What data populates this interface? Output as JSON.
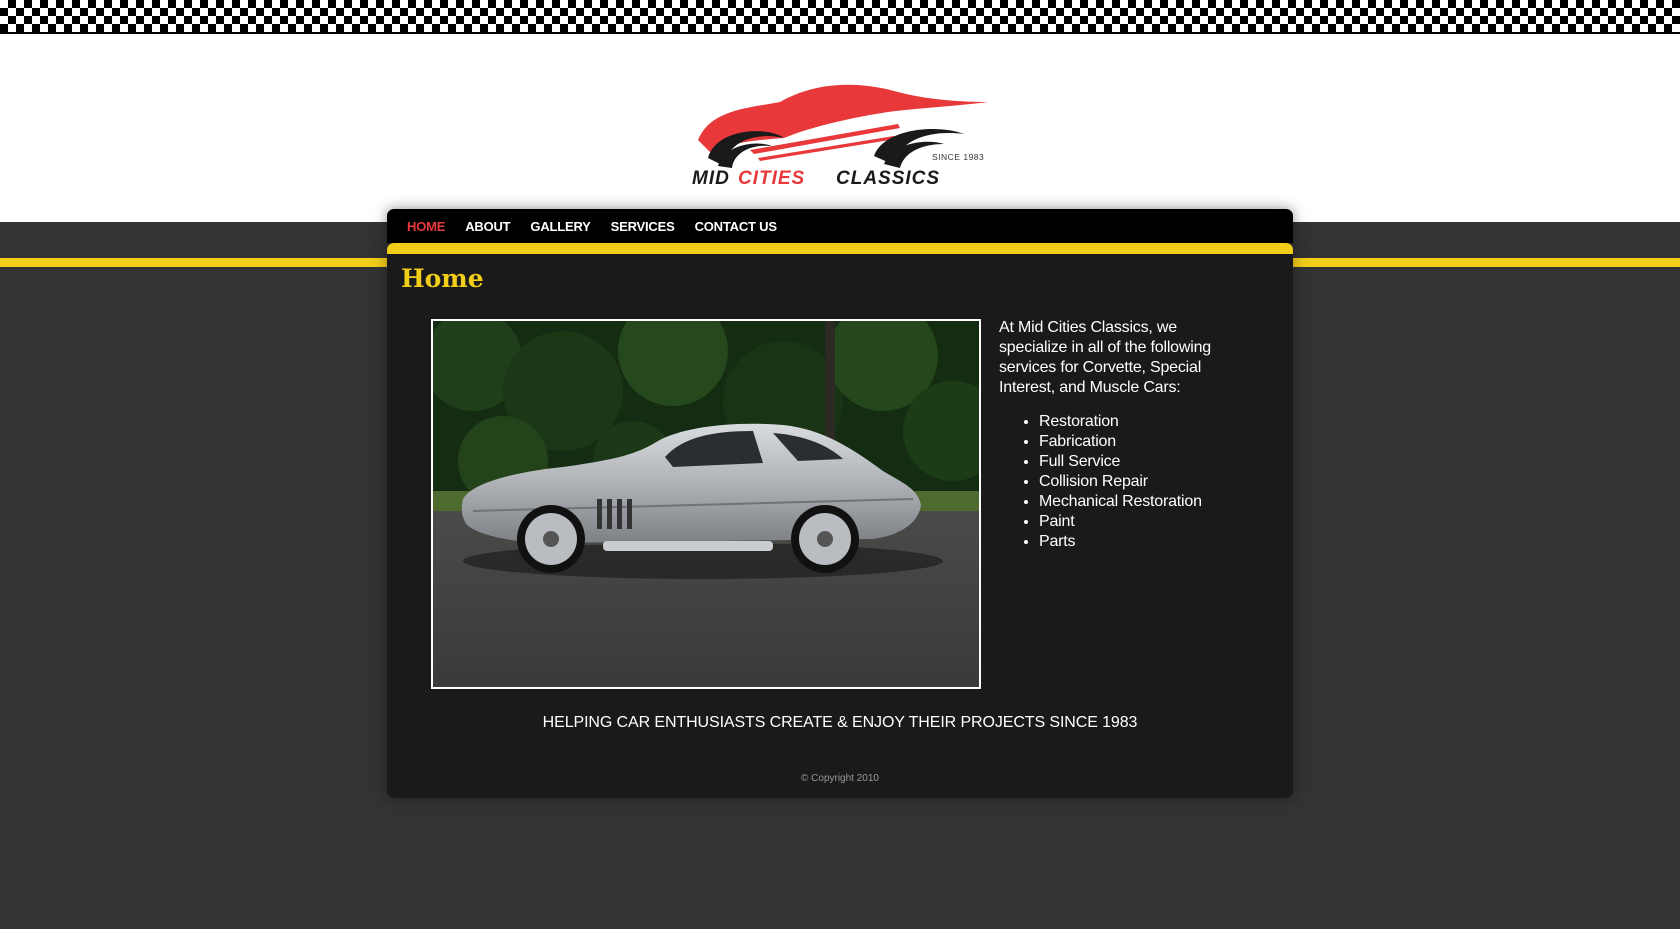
{
  "brand": {
    "logo_text_1": "MID",
    "logo_text_2": "CITIES",
    "logo_text_3": "CLASSICS",
    "logo_since": "SINCE 1983"
  },
  "nav": {
    "items": [
      {
        "label": "HOME",
        "active": true
      },
      {
        "label": "ABOUT",
        "active": false
      },
      {
        "label": "GALLERY",
        "active": false
      },
      {
        "label": "SERVICES",
        "active": false
      },
      {
        "label": "CONTACT US",
        "active": false
      }
    ]
  },
  "main": {
    "title": "Home",
    "intro": "At Mid Cities Classics, we specialize in all of the following services for Corvette, Special Interest, and Muscle Cars:",
    "services": [
      "Restoration",
      "Fabrication",
      "Full Service",
      "Collision Repair",
      "Mechanical Restoration",
      "Paint",
      "Parts"
    ],
    "tagline": "HELPING CAR ENTHUSIASTS CREATE & ENJOY THEIR PROJECTS SINCE 1983"
  },
  "footer": {
    "copyright": "© Copyright 2010"
  },
  "colors": {
    "accent_yellow": "#f2cd1a",
    "accent_red": "#e8383a",
    "panel_bg": "#1a1a1a",
    "page_bg": "#333333"
  },
  "icons": {
    "logo": "car-silhouette-logo",
    "photo": "silver-corvette-photo"
  }
}
